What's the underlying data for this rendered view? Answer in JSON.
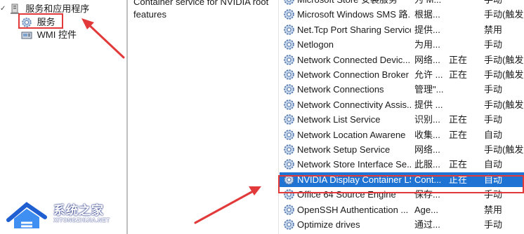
{
  "tree": {
    "parent_label": "服务和应用程序",
    "items": [
      {
        "label": "服务",
        "icon": "services-gear-icon"
      },
      {
        "label": "WMI 控件",
        "icon": "wmi-control-icon"
      }
    ]
  },
  "description": {
    "text": "Container service for NVIDIA root features"
  },
  "services": [
    {
      "name": "Microsoft Store 安装服务",
      "desc": "为 M...",
      "status": "",
      "startup": "手动"
    },
    {
      "name": "Microsoft Windows SMS 路...",
      "desc": "根据...",
      "status": "",
      "startup": "手动(触发..."
    },
    {
      "name": "Net.Tcp Port Sharing Service",
      "desc": "提供...",
      "status": "",
      "startup": "禁用"
    },
    {
      "name": "Netlogon",
      "desc": "为用...",
      "status": "",
      "startup": "手动"
    },
    {
      "name": "Network Connected Devic...",
      "desc": "网络...",
      "status": "正在",
      "startup": "手动(触发..."
    },
    {
      "name": "Network Connection Broker",
      "desc": "允许 ...",
      "status": "正在",
      "startup": "手动(触发..."
    },
    {
      "name": "Network Connections",
      "desc": "管理\"...",
      "status": "",
      "startup": "手动"
    },
    {
      "name": "Network Connectivity Assis...",
      "desc": "提供 ...",
      "status": "",
      "startup": "手动(触发..."
    },
    {
      "name": "Network List Service",
      "desc": "识别...",
      "status": "正在",
      "startup": "手动"
    },
    {
      "name": "Network Location Awarene",
      "desc": "收集...",
      "status": "正在",
      "startup": "自动"
    },
    {
      "name": "Network Setup Service",
      "desc": "网络...",
      "status": "",
      "startup": "手动(触发..."
    },
    {
      "name": "Network Store Interface Se...",
      "desc": "此服...",
      "status": "正在",
      "startup": "自动"
    },
    {
      "name": "NVIDIA Display Container LS",
      "desc": "Cont...",
      "status": "正在",
      "startup": "自动"
    },
    {
      "name": "Office 64 Source Engine",
      "desc": "保存...",
      "status": "",
      "startup": "手动"
    },
    {
      "name": "OpenSSH Authentication ...",
      "desc": "Age...",
      "status": "",
      "startup": "禁用"
    },
    {
      "name": "Optimize drives",
      "desc": "通过...",
      "status": "",
      "startup": "手动"
    }
  ],
  "selected_service_index": 12,
  "watermark": {
    "title": "系统之家",
    "subtitle": "XITONGZHIJIA.NET"
  },
  "colors": {
    "selection": "#1f73d2",
    "highlight_border": "#e23a3a",
    "arrow": "#e23a3a"
  }
}
